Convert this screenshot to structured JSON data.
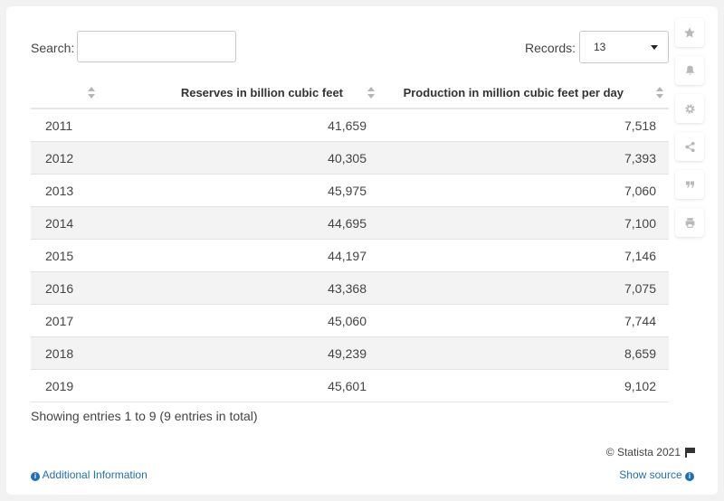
{
  "search": {
    "label": "Search:",
    "value": ""
  },
  "records": {
    "label": "Records:",
    "value": "13"
  },
  "chart_data": {
    "type": "table",
    "columns": [
      "",
      "Reserves in billion cubic feet",
      "Production in million cubic feet per day"
    ],
    "rows": [
      [
        "2011",
        "41,659",
        "7,518"
      ],
      [
        "2012",
        "40,305",
        "7,393"
      ],
      [
        "2013",
        "45,975",
        "7,060"
      ],
      [
        "2014",
        "44,695",
        "7,100"
      ],
      [
        "2015",
        "44,197",
        "7,146"
      ],
      [
        "2016",
        "43,368",
        "7,075"
      ],
      [
        "2017",
        "45,060",
        "7,744"
      ],
      [
        "2018",
        "49,239",
        "8,659"
      ],
      [
        "2019",
        "45,601",
        "9,102"
      ]
    ]
  },
  "footer": {
    "entries": "Showing entries 1 to 9 (9 entries in total)",
    "copyright": "© Statista 2021",
    "additional_info": "Additional Information",
    "show_source": "Show source"
  },
  "toolbar": {
    "icons": [
      "star-icon",
      "bell-icon",
      "gear-icon",
      "share-icon",
      "quote-icon",
      "print-icon"
    ]
  }
}
